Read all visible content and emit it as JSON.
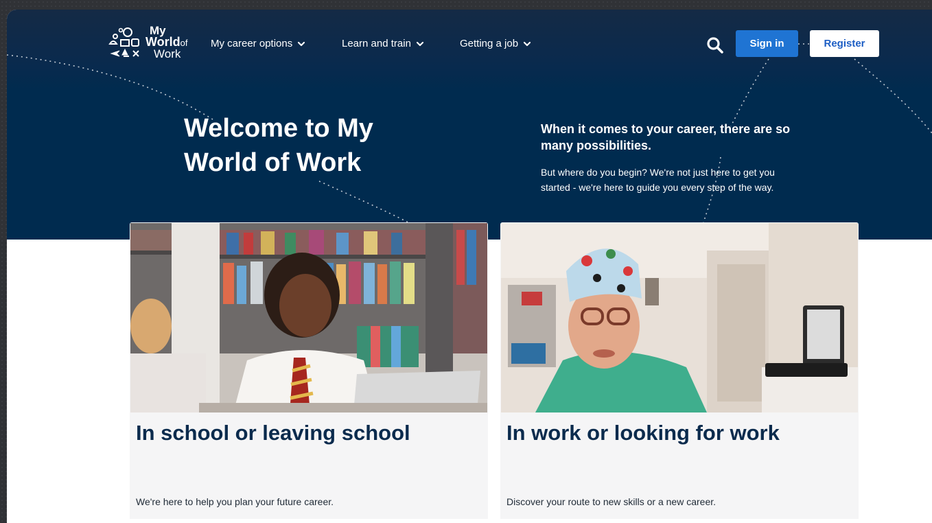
{
  "brand": {
    "line1": "My",
    "line2": "World",
    "line2_suffix": "of",
    "line3": "Work"
  },
  "nav": {
    "items": [
      {
        "label": "My career options"
      },
      {
        "label": "Learn and train"
      },
      {
        "label": "Getting a job"
      }
    ]
  },
  "header": {
    "signin_label": "Sign in",
    "register_label": "Register"
  },
  "hero": {
    "title": "Welcome to My World of Work",
    "lead": "When it comes to your career, there are so many possibilities.",
    "body": "But where do you begin? We're not just here to get you started - we're here to guide you every step of the way."
  },
  "cards": [
    {
      "title": "In school or leaving school",
      "description": "We're here to help you plan your future career."
    },
    {
      "title": "In work or looking for work",
      "description": "Discover your route to new skills or a new career."
    }
  ],
  "colors": {
    "hero_bg": "#002b4f",
    "accent_blue": "#1f74d3",
    "card_bg": "#f5f5f6",
    "title_navy": "#0b2b4d"
  },
  "icons": {
    "search": "search-icon",
    "chevron": "chevron-down-icon"
  }
}
